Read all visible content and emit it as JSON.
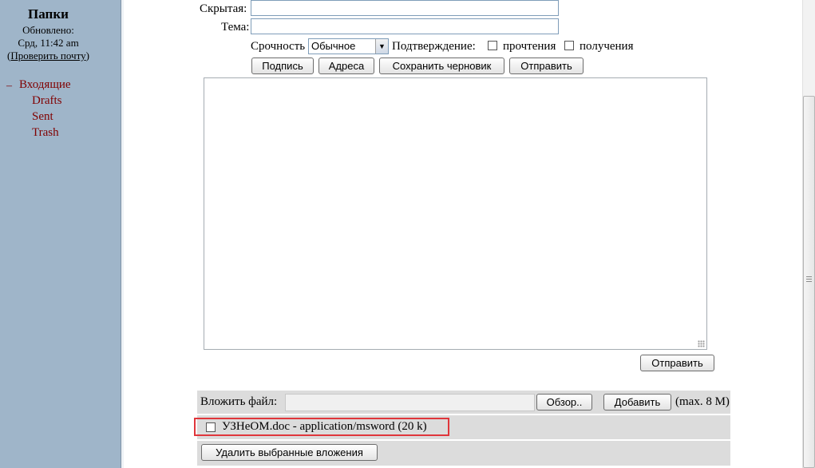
{
  "sidebar": {
    "title": "Папки",
    "updated_label": "Обновлено:",
    "updated_time": "Срд, 11:42 am",
    "check_mail_open": "(",
    "check_mail_link": "Проверить почту",
    "check_mail_close": ")",
    "collapse_symbol": "–",
    "folders": [
      "Входящие",
      "Drafts",
      "Sent",
      "Trash"
    ]
  },
  "compose": {
    "bcc_label": "Скрытая:",
    "bcc_value": "",
    "subject_label": "Тема:",
    "subject_value": "",
    "priority_label": "Срочность",
    "priority_value": "Обычное",
    "confirm_label": "Подтверждение:",
    "read_label": "прочтения",
    "delivery_label": "получения",
    "buttons": {
      "signature": "Подпись",
      "addresses": "Адреса",
      "save_draft": "Сохранить черновик",
      "send": "Отправить"
    },
    "body": "",
    "send_bottom": "Отправить"
  },
  "attachments": {
    "attach_label": "Вложить файл:",
    "browse_button": "Обзор..",
    "add_button": "Добавить",
    "max_size": "(max. 8 M)",
    "files": [
      {
        "name": "УЗНеОМ.doc - application/msword (20 k)",
        "checked": false
      }
    ],
    "delete_button": "Удалить выбранные вложения"
  },
  "colors": {
    "sidebar_bg": "#9fb5c9",
    "folder_link": "#800000",
    "attach_bg": "#dcdcdc",
    "highlight_border": "#e0363b"
  }
}
